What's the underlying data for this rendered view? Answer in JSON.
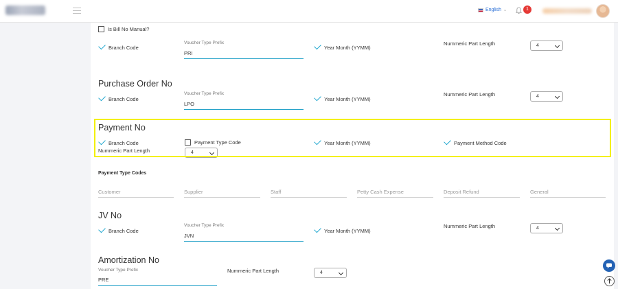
{
  "header": {
    "language": "English",
    "notification_count": "1",
    "colors": {
      "accent": "#1fa7cf",
      "badge": "#e53935",
      "highlight": "#f3f000"
    }
  },
  "top_section": {
    "bill_no_manual_label": "Is Bill No Manual?",
    "branch_code_label": "Branch Code",
    "prefix_label": "Voucher Type Prefix",
    "prefix_value": "PRI",
    "year_month_label": "Year Month (YYMM)",
    "numeric_part_label": "Nummeric Part Length",
    "numeric_part_value": "4"
  },
  "purchase_order": {
    "title": "Purchase Order No",
    "branch_code_label": "Branch Code",
    "prefix_label": "Voucher Type Prefix",
    "prefix_value": "LPO",
    "year_month_label": "Year Month (YYMM)",
    "numeric_part_label": "Nummeric Part Length",
    "numeric_part_value": "4"
  },
  "payment_no": {
    "title": "Payment No",
    "branch_code_label": "Branch Code",
    "payment_type_code_label": "Payment Type Code",
    "year_month_label": "Year Month (YYMM)",
    "payment_method_code_label": "Payment Method Code",
    "numeric_part_label": "Nummeric Part Length",
    "numeric_part_value": "4"
  },
  "payment_type_codes": {
    "title": "Payment Type Codes",
    "fields": [
      "Customer",
      "Supplier",
      "Staff",
      "Petty Cash Expense",
      "Deposit Refund",
      "General"
    ]
  },
  "jv_no": {
    "title": "JV No",
    "branch_code_label": "Branch Code",
    "prefix_label": "Voucher Type Prefix",
    "prefix_value": "JVN",
    "year_month_label": "Year Month (YYMM)",
    "numeric_part_label": "Nummeric Part Length",
    "numeric_part_value": "4"
  },
  "amortization": {
    "title": "Amortization No",
    "prefix_label": "Voucher Type Prefix",
    "prefix_value": "PRE",
    "numeric_part_label": "Nummeric Part Length",
    "numeric_part_value": "4"
  }
}
